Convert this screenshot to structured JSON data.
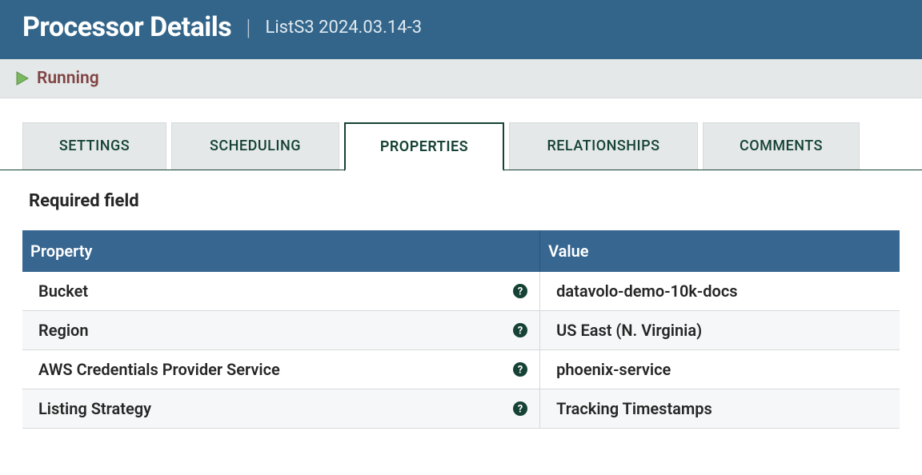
{
  "header": {
    "title": "Processor Details",
    "subtitle": "ListS3 2024.03.14-3"
  },
  "status": {
    "text": "Running"
  },
  "tabs": [
    {
      "label": "SETTINGS"
    },
    {
      "label": "SCHEDULING"
    },
    {
      "label": "PROPERTIES"
    },
    {
      "label": "RELATIONSHIPS"
    },
    {
      "label": "COMMENTS"
    }
  ],
  "properties": {
    "sectionTitle": "Required field",
    "columns": {
      "property": "Property",
      "value": "Value"
    },
    "rows": [
      {
        "property": "Bucket",
        "value": "datavolo-demo-10k-docs"
      },
      {
        "property": "Region",
        "value": "US East (N. Virginia)"
      },
      {
        "property": "AWS Credentials Provider Service",
        "value": "phoenix-service"
      },
      {
        "property": "Listing Strategy",
        "value": "Tracking Timestamps"
      }
    ]
  }
}
